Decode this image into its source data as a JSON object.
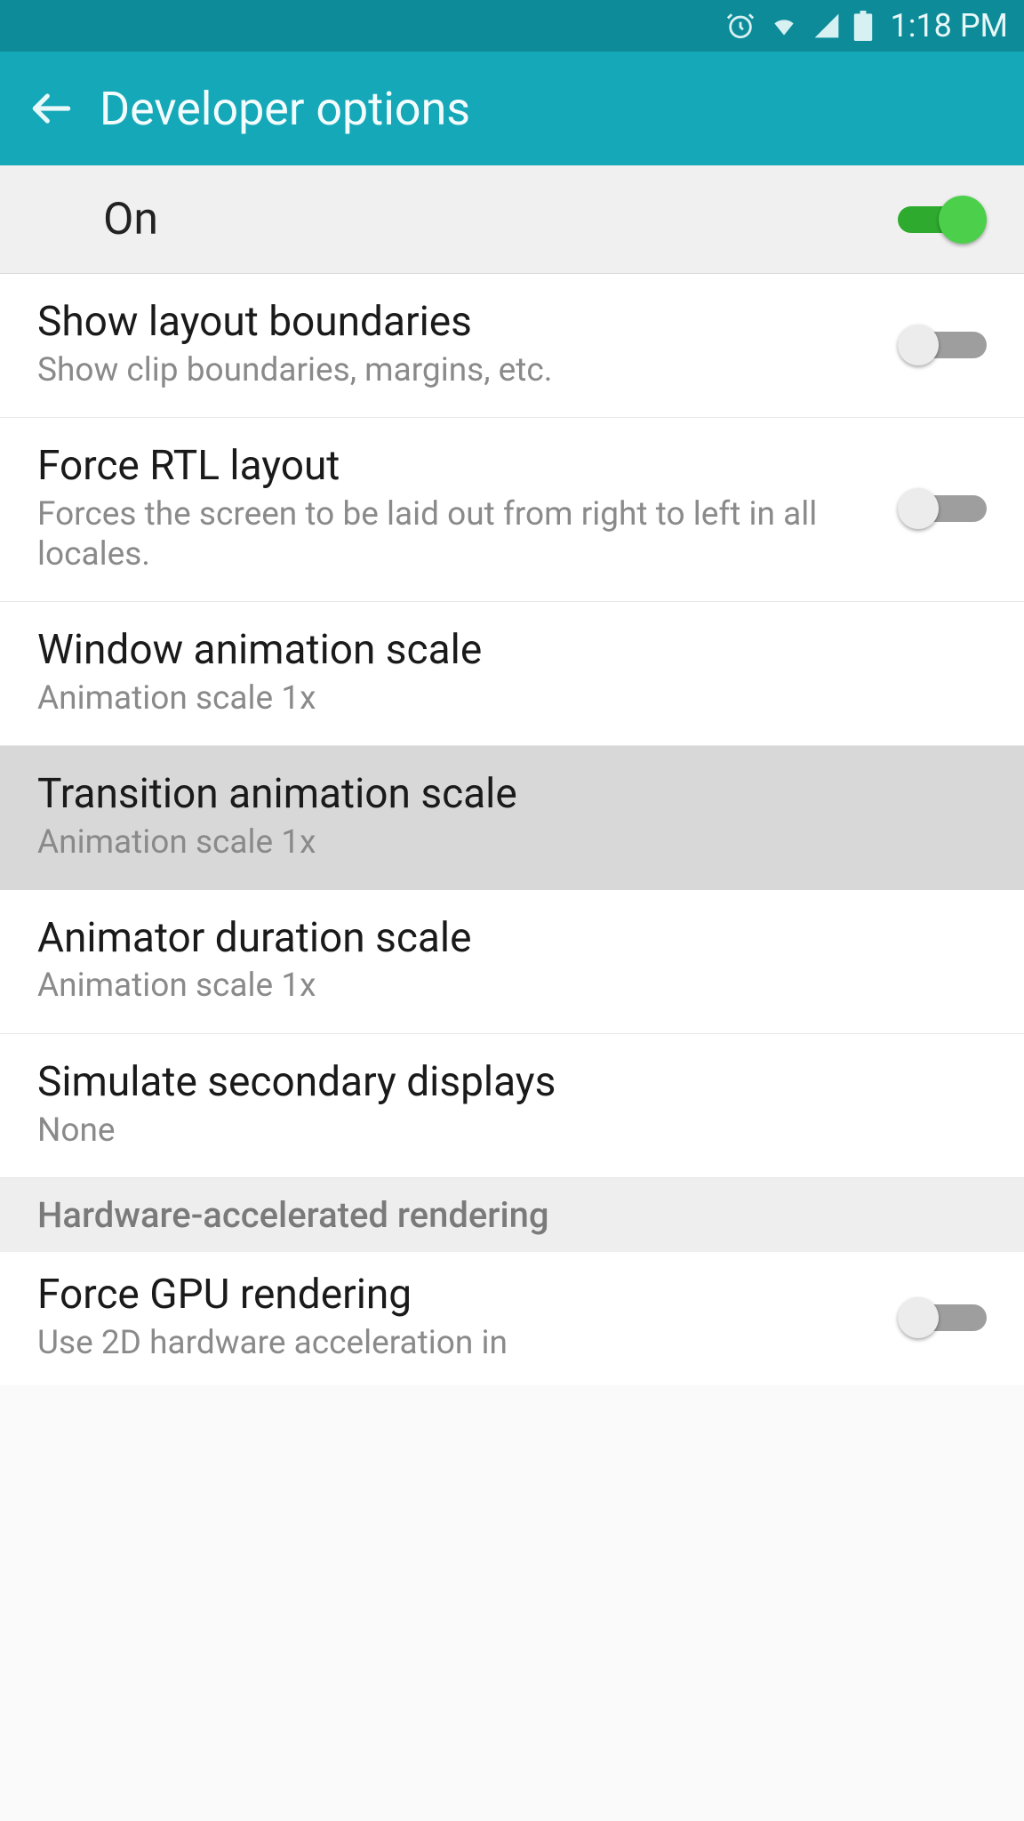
{
  "status_bar": {
    "clock": "1:18 PM",
    "icons": [
      "alarm-icon",
      "wifi-icon",
      "signal-icon",
      "battery-icon"
    ]
  },
  "app_bar": {
    "title": "Developer options"
  },
  "master_toggle": {
    "label": "On",
    "enabled": true
  },
  "settings": [
    {
      "id": "show-layout-boundaries",
      "title": "Show layout boundaries",
      "sub": "Show clip boundaries, margins, etc.",
      "type": "toggle",
      "enabled": false
    },
    {
      "id": "force-rtl-layout",
      "title": "Force RTL layout",
      "sub": "Forces the screen to be laid out from right to left in all locales.",
      "type": "toggle",
      "enabled": false
    },
    {
      "id": "window-animation-scale",
      "title": "Window animation scale",
      "sub": "Animation scale 1x",
      "type": "link"
    },
    {
      "id": "transition-animation-scale",
      "title": "Transition animation scale",
      "sub": "Animation scale 1x",
      "type": "link",
      "highlight": true
    },
    {
      "id": "animator-duration-scale",
      "title": "Animator duration scale",
      "sub": "Animation scale 1x",
      "type": "link"
    },
    {
      "id": "simulate-secondary-displays",
      "title": "Simulate secondary displays",
      "sub": "None",
      "type": "link"
    }
  ],
  "section_header": "Hardware-accelerated rendering",
  "cut_item": {
    "id": "force-gpu-rendering",
    "title": "Force GPU rendering",
    "sub": "Use 2D hardware acceleration in",
    "type": "toggle",
    "enabled": false
  }
}
